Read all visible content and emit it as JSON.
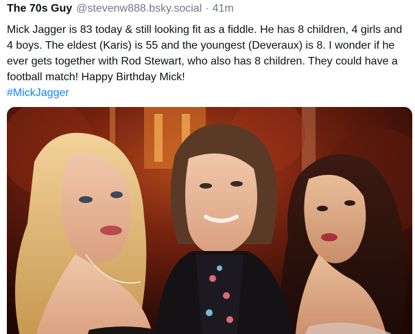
{
  "post": {
    "author": {
      "display_name": "The 70s Guy",
      "handle": "@stevenw888.bsky.social",
      "separator": "·",
      "time": "41m"
    },
    "text": "Mick Jagger is 83 today & still looking fit as a fiddle. He has 8 children, 4 girls and 4 boys. The eldest (Karis) is 55 and the youngest (Deveraux) is 8. I wonder if he ever gets together with Rod Stewart, who also has 8 children. They could have a football match! Happy Birthday Mick!",
    "hashtag": "#MickJagger"
  },
  "colors": {
    "text": "#0b0f14",
    "muted": "#6f7780",
    "link": "#1083fe"
  }
}
